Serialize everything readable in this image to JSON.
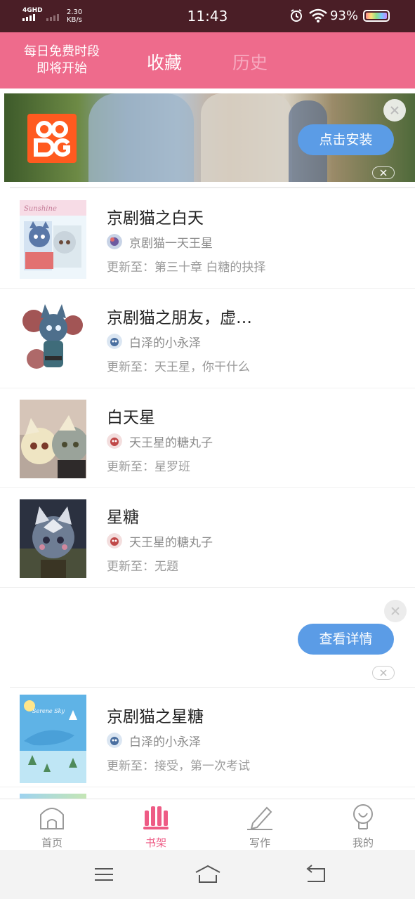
{
  "status_bar": {
    "network": "4GHD",
    "speed_value": "2.30",
    "speed_unit": "KB/s",
    "time": "11:43",
    "battery": "93%",
    "icons": [
      "signal-icon",
      "alarm-icon",
      "wifi-icon",
      "battery-icon"
    ]
  },
  "header": {
    "promo_line1": "每日免费时段",
    "promo_line2": "即将开始",
    "tabs": [
      {
        "label": "收藏",
        "active": true
      },
      {
        "label": "历史",
        "active": false
      }
    ],
    "colors": {
      "bar": "#ee6b8c",
      "active_tab": "#ffffff",
      "inactive_tab": "#f7aac0"
    }
  },
  "ad_banner": {
    "button_label": "点击安装"
  },
  "books": [
    {
      "title": "京剧猫之白天",
      "author": "京剧猫一天王星",
      "update": "更新至：第三十章 白糖的抉择",
      "cover_text": "Sunshine"
    },
    {
      "title": "京剧猫之朋友，虚…",
      "author": "白泽的小永泽",
      "update": "更新至：天王星，你干什么"
    },
    {
      "title": "白天星",
      "author": "天王星的糖丸子",
      "update": "更新至：星罗班"
    },
    {
      "title": "星糖",
      "author": "天王星的糖丸子",
      "update": "更新至：无题"
    },
    {
      "title": "京剧猫之星糖",
      "author": "白泽的小永泽",
      "update": "更新至：接受，第一次考试",
      "cover_text": "Serene Sky"
    }
  ],
  "ad_block": {
    "button_label": "查看详情"
  },
  "bottom_nav": [
    {
      "label": "首页",
      "icon": "home-icon",
      "active": false
    },
    {
      "label": "书架",
      "icon": "bookshelf-icon",
      "active": true
    },
    {
      "label": "写作",
      "icon": "pencil-icon",
      "active": false
    },
    {
      "label": "我的",
      "icon": "profile-icon",
      "active": false
    }
  ],
  "system_nav": {
    "icons": [
      "menu-icon",
      "home-system-icon",
      "back-icon"
    ]
  },
  "accent_color": "#ee5b85",
  "button_color": "#5b9ce6"
}
